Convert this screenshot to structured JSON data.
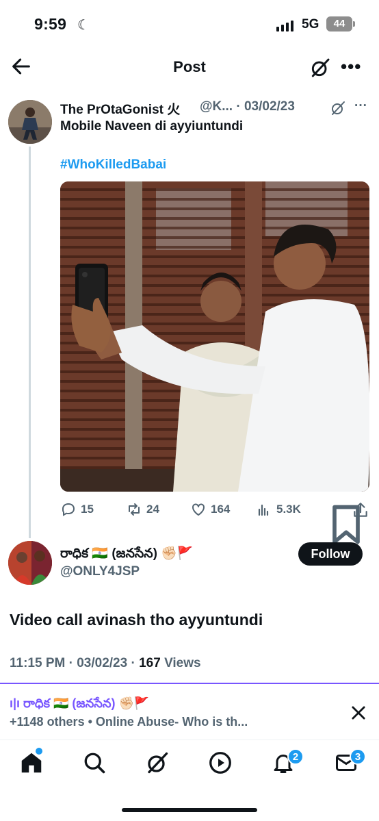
{
  "status_bar": {
    "time": "9:59",
    "network": "5G",
    "battery": "44"
  },
  "header": {
    "title": "Post"
  },
  "parent_tweet": {
    "display_name": "The PrOtaGonist 火",
    "handle_date": "@K... · 03/02/23",
    "text": "Mobile Naveen di ayyiuntundi",
    "hashtag": "#WhoKilledBabai",
    "replies": "15",
    "reposts": "24",
    "likes": "164",
    "views": "5.3K"
  },
  "reply": {
    "display_name": "రాధిక 🇮🇳 (జనసేన) ✊🏻🚩",
    "handle": "@ONLY4JSP",
    "follow_label": "Follow",
    "text": "Video call avinash tho ayyuntundi",
    "time": "11:15 PM",
    "date": "03/02/23",
    "views_count": "167",
    "views_label": "Views"
  },
  "bottom_banner": {
    "line1": "ı|ı రాధిక 🇮🇳 (జనసేన) ✊🏻🚩",
    "line2": "+1148 others • Online Abuse- Who is th..."
  },
  "nav": {
    "notifications_badge": "2",
    "messages_badge": "3"
  },
  "colors": {
    "accent": "#1d9bf0",
    "spaces_purple": "#7856ff",
    "text": "#0f1419",
    "muted": "#536471"
  }
}
